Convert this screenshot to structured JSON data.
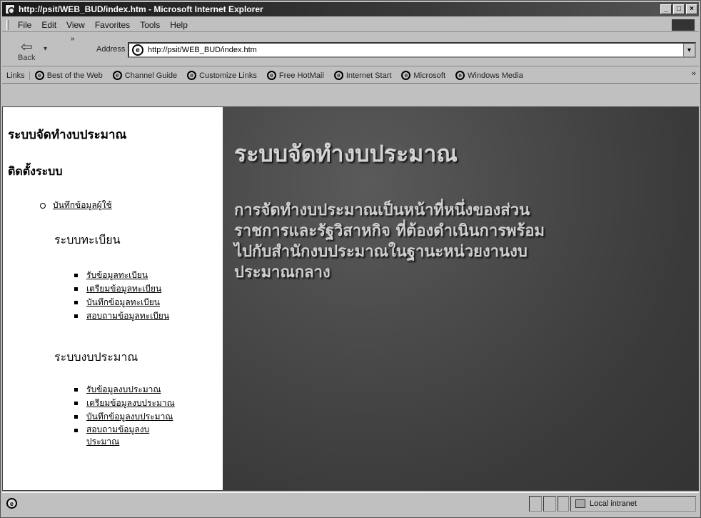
{
  "window": {
    "title": "http://psit/WEB_BUD/index.htm - Microsoft Internet Explorer",
    "controls": [
      "_",
      "□",
      "×"
    ]
  },
  "menu": [
    "File",
    "Edit",
    "View",
    "Favorites",
    "Tools",
    "Help"
  ],
  "toolbar": {
    "back_label": "Back",
    "address_label": "Address",
    "address_value": "http://psit/WEB_BUD/index.htm"
  },
  "links": {
    "label": "Links",
    "items": [
      "Best of the Web",
      "Channel Guide",
      "Customize Links",
      "Free HotMail",
      "Internet Start",
      "Microsoft",
      "Windows Media"
    ]
  },
  "left_frame": {
    "title": "ระบบจัดทำงบประมาณ",
    "install": "ติดตั้งระบบ",
    "user_entry": "บันทึกข้อมูลผู้ใช้",
    "registration": {
      "heading": "ระบบทะเบียน",
      "items": [
        "รับข้อมูลทะเบียน",
        "เตรียมข้อมูลทะเบียน",
        "บันทึกข้อมูลทะเบียน",
        "สอบถามข้อมูลทะเบียน"
      ]
    },
    "budget": {
      "heading": "ระบบงบประมาณ",
      "items": [
        "รับข้อมูลงบประมาณ",
        "เตรียมข้อมูลงบประมาณ",
        "บันทึกข้อมูลงบประมาณ"
      ],
      "last_item_line1": "สอบถามข้อมูลงบ",
      "last_item_line2": "ประมาณ"
    }
  },
  "main_frame": {
    "title": "ระบบจัดทำงบประมาณ",
    "paragraph_lines": [
      "การจัดทำงบประมาณเป็นหน้าที่หนึ่งของส่วน",
      "ราชการและรัฐวิสาหกิจ ที่ต้องดำเนินการพร้อม",
      "ไปกับสำนักงบประมาณในฐานะหน่วยงานงบ",
      "ประมาณกลาง"
    ]
  },
  "status": {
    "zone": "Local intranet"
  }
}
